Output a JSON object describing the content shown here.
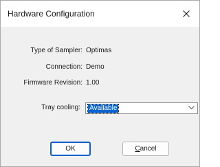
{
  "window": {
    "title": "Hardware Configuration",
    "close_icon": "close-icon"
  },
  "info": [
    {
      "label": "Type of Sampler:",
      "value": "Optimas"
    },
    {
      "label": "Connection:",
      "value": "Demo"
    },
    {
      "label": "Firmware Revision:",
      "value": "1.00"
    }
  ],
  "tray_cooling": {
    "label": "Tray cooling:",
    "selected": "Available",
    "dropdown_icon": "chevron-down-icon"
  },
  "buttons": {
    "ok_label": "OK",
    "cancel_mnemonic": "C",
    "cancel_rest": "ancel"
  },
  "colors": {
    "selection": "#0a64d2",
    "default_button_border": "#0a5fcf"
  }
}
